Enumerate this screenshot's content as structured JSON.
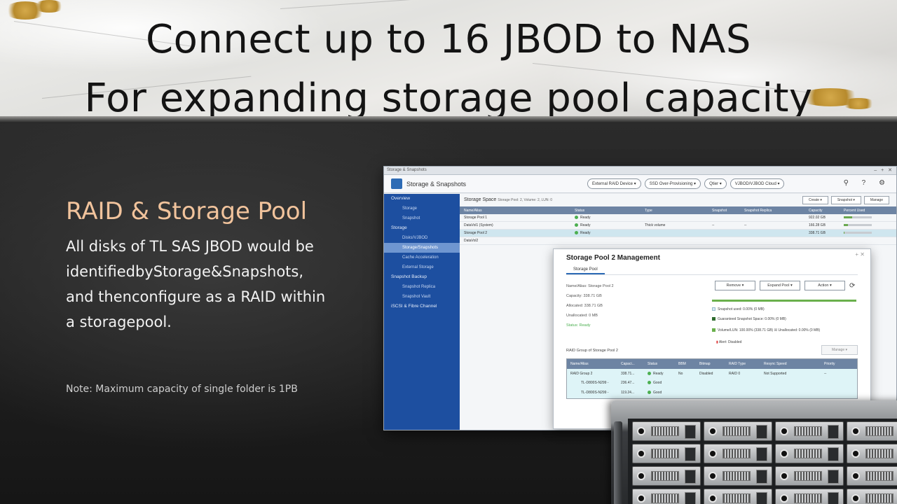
{
  "hero": {
    "line1": "Connect up to 16 JBOD to NAS",
    "line2": "For expanding storage pool capacity"
  },
  "section": {
    "heading": "RAID & Storage Pool",
    "body_lines": [
      "All disks of TL SAS JBOD would be",
      "identifiedbyStorage&Snapshots,",
      "and thenconfigure as a RAID within",
      "a storagepool."
    ],
    "note": "Note: Maximum capacity of single folder is 1PB"
  },
  "app": {
    "window_title": "Storage & Snapshots",
    "window_controls": "– + ✕",
    "name": "Storage & Snapshots",
    "toolbar_buttons": [
      "External RAID Device ▾",
      "SSD Over-Provisioning ▾",
      "Qtier ▾",
      "VJBOD/VJBOD Cloud ▾"
    ],
    "tools": "⚲ ? ⚙",
    "sidebar": [
      {
        "label": "Overview",
        "type": "grp"
      },
      {
        "label": "Storage",
        "type": "sub"
      },
      {
        "label": "Snapshot",
        "type": "sub"
      },
      {
        "label": "Storage",
        "type": "grp"
      },
      {
        "label": "Disks/VJBOD",
        "type": "sub"
      },
      {
        "label": "Storage/Snapshots",
        "type": "sub",
        "active": true
      },
      {
        "label": "Cache Acceleration",
        "type": "sub"
      },
      {
        "label": "External Storage",
        "type": "sub"
      },
      {
        "label": "Snapshot Backup",
        "type": "grp"
      },
      {
        "label": "Snapshot Replica",
        "type": "sub"
      },
      {
        "label": "Snapshot Vault",
        "type": "sub"
      },
      {
        "label": "iSCSI & Fibre Channel",
        "type": "grp"
      }
    ],
    "storage_space": {
      "title": "Storage Space",
      "subtitle": "Storage Pool: 2, Volume: 2, LUN: 0",
      "buttons": [
        "Create ▾",
        "Snapshot ▾",
        "Manage"
      ],
      "columns": [
        "Name/Alias",
        "Status",
        "Type",
        "Snapshot",
        "Snapshot Replica",
        "Capacity",
        "Percent Used"
      ],
      "rows": [
        {
          "name": "Storage Pool 1",
          "status": "Ready",
          "type": "",
          "snapshot": "",
          "replica": "",
          "capacity": "922.02 GB",
          "used": 0.3,
          "selected": false
        },
        {
          "name": "DataVol1 (System)",
          "status": "Ready",
          "type": "Thick volume",
          "snapshot": "--",
          "replica": "--",
          "capacity": "166.28 GB",
          "used": 0.15,
          "selected": false
        },
        {
          "name": "Storage Pool 2",
          "status": "Ready",
          "type": "",
          "snapshot": "",
          "replica": "",
          "capacity": "338.71 GB",
          "used": 0.02,
          "selected": true
        },
        {
          "name": "DataVol2",
          "status": "",
          "type": "",
          "snapshot": "",
          "replica": "",
          "capacity": "",
          "used": null,
          "selected": false
        }
      ]
    }
  },
  "modal": {
    "title": "Storage Pool 2 Management",
    "close": "+ ✕",
    "tab": "Storage Pool",
    "info": [
      "Name/Alias: Storage Pool 2",
      "Capacity: 338.71 GB",
      "Allocated: 338.71 GB",
      "Unallocated: 0 MB",
      "Status: Ready"
    ],
    "buttons": [
      "Remove ▾",
      "Expand Pool ▾",
      "Action ▾"
    ],
    "legend": [
      {
        "text": "Snapshot used: 0.00% (0 MB)",
        "color": "#d7eaf5"
      },
      {
        "text": "Guaranteed Snapshot Space: 0.00% (0 MB)",
        "color": "#2e6b2e"
      },
      {
        "text": "Volume/LUN: 100.00% (338.71 GB) ☒ Unallocated: 0.00% (0 MB)",
        "color": "#6ab04c"
      }
    ],
    "alert": "Alert: Disabled",
    "raid_label": "RAID Group of Storage Pool 2",
    "manage": "Manage ▾",
    "raid_columns": [
      "Name/Alias",
      "Capaci...",
      "Status",
      "BBM",
      "Bitmap",
      "RAID Type",
      "Resync Speed",
      "Priority"
    ],
    "raid_rows": [
      [
        "RAID Group 2",
        "338.71...",
        "Ready",
        "No",
        "Disabled",
        "RAID 0",
        "Not Supported",
        "--"
      ],
      [
        "TL-D800S-N299 -",
        "236.47...",
        "Good",
        "",
        "",
        "",
        "",
        ""
      ],
      [
        "TL-D800S-N299 -",
        "119.24...",
        "Good",
        "",
        "",
        "",
        "",
        ""
      ]
    ]
  }
}
